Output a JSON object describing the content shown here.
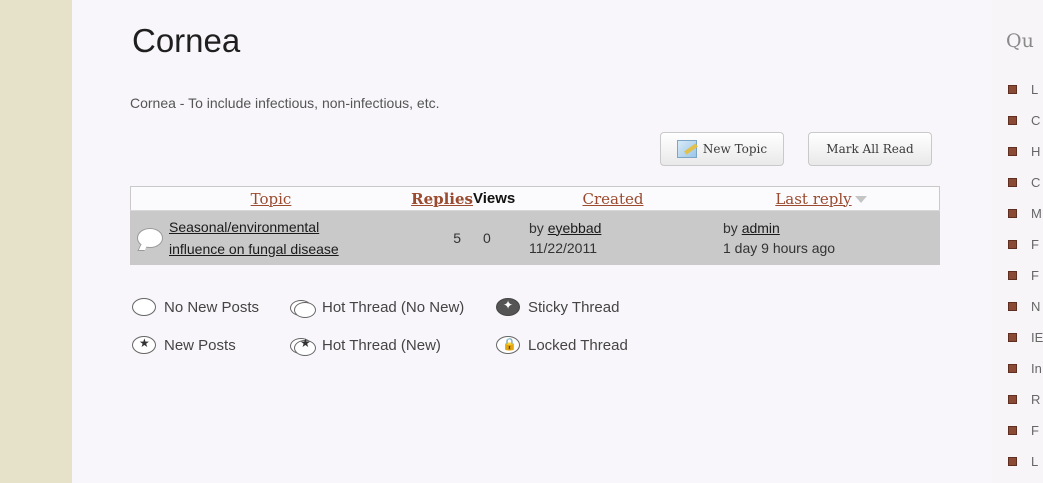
{
  "page": {
    "title": "Cornea",
    "description": "Cornea - To include infectious, non-infectious, etc."
  },
  "buttons": {
    "new_topic": "New Topic",
    "mark_all_read": "Mark All Read"
  },
  "table": {
    "headers": {
      "topic": "Topic",
      "replies": "Replies",
      "views": "Views",
      "created": "Created",
      "last_reply": "Last reply"
    },
    "rows": [
      {
        "title_line1": "Seasonal/environmental",
        "title_line2": "influence on fungal disease",
        "replies": "5",
        "views": "0",
        "created_by_prefix": "by",
        "created_by": "eyebbad",
        "created_date": "11/22/2011",
        "last_by_prefix": "by",
        "last_by": "admin",
        "last_time": "1 day 9 hours ago"
      }
    ]
  },
  "legend": {
    "no_new_posts": "No New Posts",
    "hot_thread_no_new": "Hot Thread (No New)",
    "sticky_thread": "Sticky Thread",
    "new_posts": "New Posts",
    "hot_thread_new": "Hot Thread (New)",
    "locked_thread": "Locked Thread"
  },
  "sidebar": {
    "heading": "Qu",
    "items": [
      "L",
      "C",
      "H",
      "C",
      "M",
      "F",
      "F",
      "N",
      "IE",
      "In",
      "R",
      "F",
      "L"
    ]
  },
  "colors": {
    "left_strip": "#e6e2c9",
    "header_link": "#9a4a2e",
    "row_bg": "#c9c9c9",
    "bullet": "#8a4a36"
  }
}
